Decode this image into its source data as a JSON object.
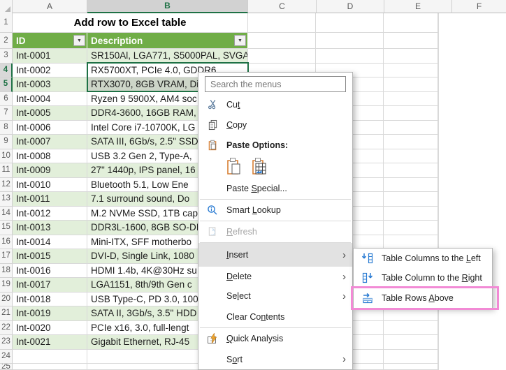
{
  "sheet": {
    "column_headers": [
      "A",
      "B",
      "C",
      "D",
      "E",
      "F"
    ],
    "selected_column": "B",
    "selected_row_numbers": [
      4,
      5
    ],
    "visible_row_count": 25,
    "title": "Add row to Excel table",
    "table_header": {
      "id": "ID",
      "description": "Description"
    },
    "rows": [
      {
        "row": 3,
        "id": "Int-0001",
        "description": "SR150Al, LGA771, S5000PAL, SVGA"
      },
      {
        "row": 4,
        "id": "Int-0002",
        "description": "RX5700XT, PCIe 4.0, GDDR6"
      },
      {
        "row": 5,
        "id": "Int-0003",
        "description": "RTX3070, 8GB VRAM, Di",
        "selected": true
      },
      {
        "row": 6,
        "id": "Int-0004",
        "description": "Ryzen 9 5900X, AM4 soc"
      },
      {
        "row": 7,
        "id": "Int-0005",
        "description": "DDR4-3600, 16GB RAM,"
      },
      {
        "row": 8,
        "id": "Int-0006",
        "description": "Intel Core i7-10700K, LG"
      },
      {
        "row": 9,
        "id": "Int-0007",
        "description": "SATA III, 6Gb/s, 2.5\" SSD"
      },
      {
        "row": 10,
        "id": "Int-0008",
        "description": "USB 3.2 Gen 2, Type-A,"
      },
      {
        "row": 11,
        "id": "Int-0009",
        "description": "27\" 1440p, IPS panel, 16"
      },
      {
        "row": 12,
        "id": "Int-0010",
        "description": "Bluetooth 5.1, Low Ene"
      },
      {
        "row": 13,
        "id": "Int-0011",
        "description": "7.1 surround sound, Do"
      },
      {
        "row": 14,
        "id": "Int-0012",
        "description": "M.2 NVMe SSD, 1TB cap"
      },
      {
        "row": 15,
        "id": "Int-0013",
        "description": "DDR3L-1600, 8GB SO-DI"
      },
      {
        "row": 16,
        "id": "Int-0014",
        "description": "Mini-ITX, SFF motherbo"
      },
      {
        "row": 17,
        "id": "Int-0015",
        "description": "DVI-D, Single Link, 1080"
      },
      {
        "row": 18,
        "id": "Int-0016",
        "description": "HDMI 1.4b, 4K@30Hz su"
      },
      {
        "row": 19,
        "id": "Int-0017",
        "description": "LGA1151, 8th/9th Gen c"
      },
      {
        "row": 20,
        "id": "Int-0018",
        "description": "USB Type-C, PD 3.0, 100"
      },
      {
        "row": 21,
        "id": "Int-0019",
        "description": "SATA II, 3Gb/s, 3.5\" HDD"
      },
      {
        "row": 22,
        "id": "Int-0020",
        "description": "PCIe x16, 3.0, full-lengt"
      },
      {
        "row": 23,
        "id": "Int-0021",
        "description": "Gigabit Ethernet, RJ-45"
      }
    ]
  },
  "context_menu": {
    "search_placeholder": "Search the menus",
    "items": {
      "cut": {
        "pre": "Cu",
        "key": "t",
        "post": ""
      },
      "copy": {
        "pre": "",
        "key": "C",
        "post": "opy"
      },
      "paste_options": {
        "pre": "Paste Options:",
        "key": "",
        "post": ""
      },
      "paste_special": {
        "pre": "Paste ",
        "key": "S",
        "post": "pecial..."
      },
      "smart_lookup": {
        "pre": "Smart ",
        "key": "L",
        "post": "ookup"
      },
      "refresh": {
        "pre": "",
        "key": "R",
        "post": "efresh",
        "disabled": true
      },
      "insert": {
        "pre": "",
        "key": "I",
        "post": "nsert",
        "has_submenu": true,
        "highlighted": true
      },
      "delete": {
        "pre": "",
        "key": "D",
        "post": "elete",
        "has_submenu": true
      },
      "select": {
        "pre": "Se",
        "key": "l",
        "post": "ect",
        "has_submenu": true
      },
      "clear_contents": {
        "pre": "Clear Co",
        "key": "n",
        "post": "tents"
      },
      "quick_analysis": {
        "pre": "",
        "key": "Q",
        "post": "uick Analysis"
      },
      "sort": {
        "pre": "S",
        "key": "o",
        "post": "rt",
        "has_submenu": true
      }
    }
  },
  "insert_submenu": {
    "items": {
      "table_columns_left": {
        "pre": "Table Columns to the ",
        "key": "L",
        "post": "eft"
      },
      "table_column_right": {
        "pre": "Table Column to the ",
        "key": "R",
        "post": "ight"
      },
      "table_rows_above": {
        "pre": "Table Rows ",
        "key": "A",
        "post": "bove",
        "annotated": true
      }
    }
  },
  "colors": {
    "excel_green": "#1E7145",
    "table_header_green": "#70AD47",
    "banded_row_green": "#E2EFDA",
    "selected_cell_fill": "#CDD5C8",
    "menu_highlight": "#E2E2E2",
    "annotation_pink": "#F28AD5",
    "icon_blue": "#2B7CD3",
    "icon_orange": "#D77F33"
  }
}
